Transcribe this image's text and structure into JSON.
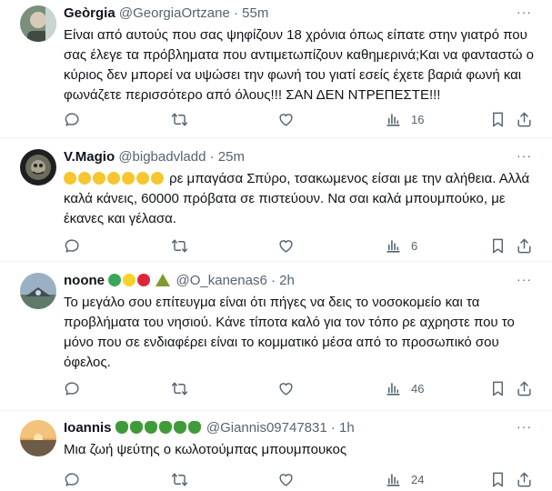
{
  "tweets": [
    {
      "name": "Geòrgia",
      "handle": "@GeorgiaOrtzane",
      "time": "55m",
      "text": "Είναι από αυτούς που σας ψηφίζουν 18 χρόνια όπως είπατε στην γιατρό που σας έλεγε τα πρόβληματα που αντιμετωπίζουν καθημερινά;Και να φανταστώ ο κύριος δεν μπορεί να υψώσει την φωνή του γιατί εσείς έχετε βαριά φωνή και φωνάζετε περισσότερο από όλους!!! ΣΑΝ ΔΕΝ ΝΤΡΕΠΕΣΤΕ!!!",
      "views": "16"
    },
    {
      "name": "V.Magio",
      "handle": "@bigbadvladd",
      "time": "25m",
      "text_after_emoji": "ρε μπαγάσα Σπύρο, τσακωμενος είσαι με την αλήθεια. Αλλά καλά κάνεις, 60000 πρόβατα σε πιστεύουν. Να σαι καλά μπουμπούκο, με έκανες και γέλασα.",
      "views": "6"
    },
    {
      "name": "noone",
      "handle": "@O_kanenas6",
      "time": "2h",
      "text": "Το μεγάλο σου επίτευγμα είναι ότι πήγες να δεις το νοσοκομείο και τα προβλήματα του νησιού.  Κάνε τίποτα καλό για τον τόπο ρε αχρηστε που το μόνο που σε ενδιαφέρει είναι το κομματικό μέσα από το προσωπικό σου όφελος.",
      "views": "46"
    },
    {
      "name": "Ioannis",
      "handle": "@Giannis09747831",
      "time": "1h",
      "text": "Μια ζωή ψεύτης ο κωλοτούμπας μπουμπουκος",
      "views": "24"
    }
  ],
  "separator": "·",
  "more_glyph": "···",
  "icons": [
    "reply-icon",
    "retweet-icon",
    "like-icon",
    "views-icon",
    "bookmark-icon",
    "share-icon"
  ]
}
